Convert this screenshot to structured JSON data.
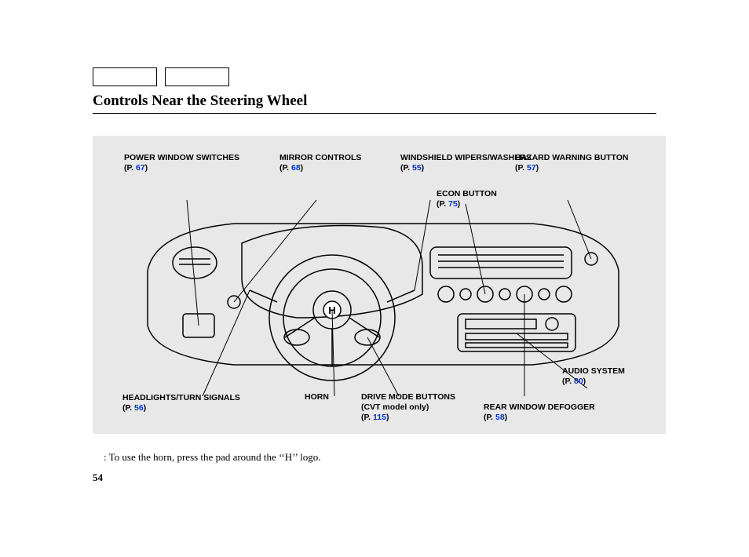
{
  "title": "Controls Near the Steering Wheel",
  "callouts": {
    "power_window": {
      "label": "POWER WINDOW SWITCHES",
      "page": "67"
    },
    "mirror": {
      "label": "MIRROR CONTROLS",
      "page": "68"
    },
    "windshield": {
      "label": "WINDSHIELD WIPERS/WASHERS",
      "page": "55"
    },
    "hazard": {
      "label": "HAZARD WARNING BUTTON",
      "page": "57"
    },
    "econ": {
      "label": "ECON BUTTON",
      "page": "75"
    },
    "headlights": {
      "label": "HEADLIGHTS/TURN SIGNALS",
      "page": "56"
    },
    "horn": {
      "label": "HORN"
    },
    "drive_mode": {
      "label": "DRIVE MODE BUTTONS",
      "sub": "(CVT model only)",
      "page": "115"
    },
    "rear_defog": {
      "label": "REAR WINDOW DEFOGGER",
      "page": "58"
    },
    "audio": {
      "label": "AUDIO SYSTEM",
      "page": "80"
    }
  },
  "note": "To use the horn, press the pad around the ‘‘H’’ logo.",
  "page_number": "54",
  "ref_prefix": "(P. ",
  "ref_suffix": ")"
}
